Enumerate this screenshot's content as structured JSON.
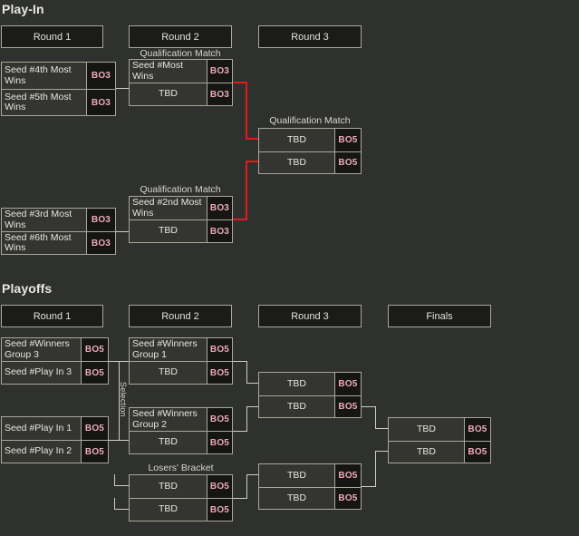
{
  "theme": {
    "page_bg": "#2f312e",
    "box_bg": "#343531",
    "box_border": "#a9a79b",
    "header_bg": "#1b1b1a",
    "format_bg": "#151514",
    "format_text": "#eca9bc",
    "text": "#e8e6df",
    "connector": "#cfcec4",
    "connector_highlight": "#e01b1b"
  },
  "sections": [
    {
      "title": "Play-In",
      "round_headers": [
        {
          "label": "Round 1"
        },
        {
          "label": "Round 2"
        },
        {
          "label": "Round 3"
        }
      ],
      "captions": [
        {
          "label": "Qualification Match"
        },
        {
          "label": "Qualification Match"
        },
        {
          "label": "Qualification Match"
        }
      ],
      "matches": [
        {
          "id": "playin-r1-upper",
          "rows": [
            {
              "team": "Seed #4th Most Wins",
              "format": "BO3",
              "align": "left"
            },
            {
              "team": "Seed #5th Most Wins",
              "format": "BO3",
              "align": "left"
            }
          ]
        },
        {
          "id": "playin-r1-lower",
          "rows": [
            {
              "team": "Seed #3rd Most Wins",
              "format": "BO3",
              "align": "left"
            },
            {
              "team": "Seed #6th Most Wins",
              "format": "BO3",
              "align": "left"
            }
          ]
        },
        {
          "id": "playin-r2-upper",
          "caption": "Qualification Match",
          "rows": [
            {
              "team": "Seed #Most Wins",
              "format": "BO3",
              "align": "left"
            },
            {
              "team": "TBD",
              "format": "BO3",
              "align": "center"
            }
          ]
        },
        {
          "id": "playin-r2-lower",
          "caption": "Qualification Match",
          "rows": [
            {
              "team": "Seed #2nd Most Wins",
              "format": "BO3",
              "align": "left"
            },
            {
              "team": "TBD",
              "format": "BO3",
              "align": "center"
            }
          ]
        },
        {
          "id": "playin-r3",
          "caption": "Qualification Match",
          "rows": [
            {
              "team": "TBD",
              "format": "BO5",
              "align": "center"
            },
            {
              "team": "TBD",
              "format": "BO5",
              "align": "center"
            }
          ]
        }
      ]
    },
    {
      "title": "Playoffs",
      "round_headers": [
        {
          "label": "Round 1"
        },
        {
          "label": "Round 2"
        },
        {
          "label": "Round 3"
        },
        {
          "label": "Finals"
        }
      ],
      "captions": [
        {
          "label": "Losers' Bracket"
        }
      ],
      "selection_label": "Selection",
      "matches": [
        {
          "id": "po-r1-upper",
          "rows": [
            {
              "team": "Seed #Winners Group 3",
              "format": "BO5",
              "align": "left"
            },
            {
              "team": "Seed #Play In 3",
              "format": "BO5",
              "align": "left"
            }
          ]
        },
        {
          "id": "po-r1-lower",
          "rows": [
            {
              "team": "Seed #Play In 1",
              "format": "BO5",
              "align": "left"
            },
            {
              "team": "Seed #Play In 2",
              "format": "BO5",
              "align": "left"
            }
          ]
        },
        {
          "id": "po-r2-upper",
          "rows": [
            {
              "team": "Seed #Winners Group 1",
              "format": "BO5",
              "align": "left"
            },
            {
              "team": "TBD",
              "format": "BO5",
              "align": "center"
            }
          ]
        },
        {
          "id": "po-r2-mid",
          "rows": [
            {
              "team": "Seed #Winners Group 2",
              "format": "BO5",
              "align": "left"
            },
            {
              "team": "TBD",
              "format": "BO5",
              "align": "center"
            }
          ]
        },
        {
          "id": "po-r2-losers",
          "caption": "Losers' Bracket",
          "rows": [
            {
              "team": "TBD",
              "format": "BO5",
              "align": "center"
            },
            {
              "team": "TBD",
              "format": "BO5",
              "align": "center"
            }
          ]
        },
        {
          "id": "po-r3-upper",
          "rows": [
            {
              "team": "TBD",
              "format": "BO5",
              "align": "center"
            },
            {
              "team": "TBD",
              "format": "BO5",
              "align": "center"
            }
          ]
        },
        {
          "id": "po-r3-lower",
          "rows": [
            {
              "team": "TBD",
              "format": "BO5",
              "align": "center"
            },
            {
              "team": "TBD",
              "format": "BO5",
              "align": "center"
            }
          ]
        },
        {
          "id": "po-finals",
          "rows": [
            {
              "team": "TBD",
              "format": "BO5",
              "align": "center"
            },
            {
              "team": "TBD",
              "format": "BO5",
              "align": "center"
            }
          ]
        }
      ]
    }
  ]
}
